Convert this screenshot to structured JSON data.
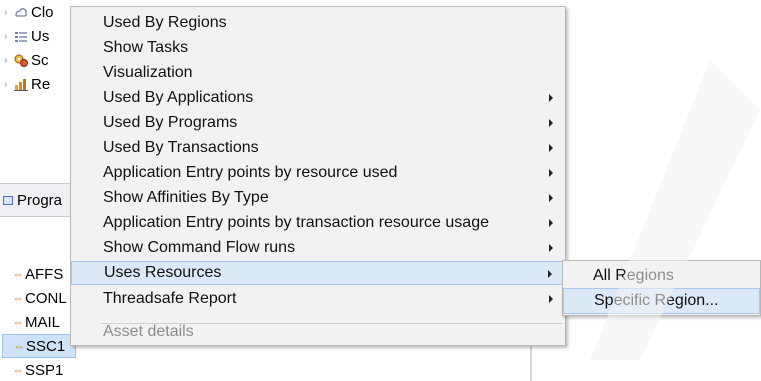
{
  "tree": {
    "items": [
      {
        "label": "Clo",
        "icon": "cloud-icon"
      },
      {
        "label": "Us",
        "icon": "list-icon"
      },
      {
        "label": "Sc",
        "icon": "gears-icon"
      },
      {
        "label": "Re",
        "icon": "chart-icon"
      }
    ]
  },
  "view_tab": {
    "label": "Progra"
  },
  "program_list": {
    "items": [
      {
        "label": "AFFS"
      },
      {
        "label": "CONL"
      },
      {
        "label": "MAIL"
      },
      {
        "label": "SSC1"
      },
      {
        "label": "SSP1"
      }
    ]
  },
  "context_menu": {
    "items": [
      {
        "label": "Used By Regions"
      },
      {
        "label": "Show Tasks"
      },
      {
        "label": "Visualization"
      },
      {
        "label": "Used By Applications"
      },
      {
        "label": "Used By Programs"
      },
      {
        "label": "Used By Transactions"
      },
      {
        "label": "Application Entry points by resource used"
      },
      {
        "label": "Show Affinities By Type"
      },
      {
        "label": "Application Entry points by transaction resource usage"
      },
      {
        "label": "Show Command Flow runs"
      },
      {
        "label": "Uses Resources"
      },
      {
        "label": "Threadsafe Report"
      },
      {
        "label": "Asset details"
      }
    ]
  },
  "submenu": {
    "items": [
      {
        "label": "All Regions"
      },
      {
        "label": "Specific Region..."
      }
    ]
  },
  "colors": {
    "menu_bg": "#f2f2f2",
    "hover_bg": "#dbe8f8",
    "hover_border": "#a9c7ee",
    "disabled_text": "#8c8c8c"
  }
}
